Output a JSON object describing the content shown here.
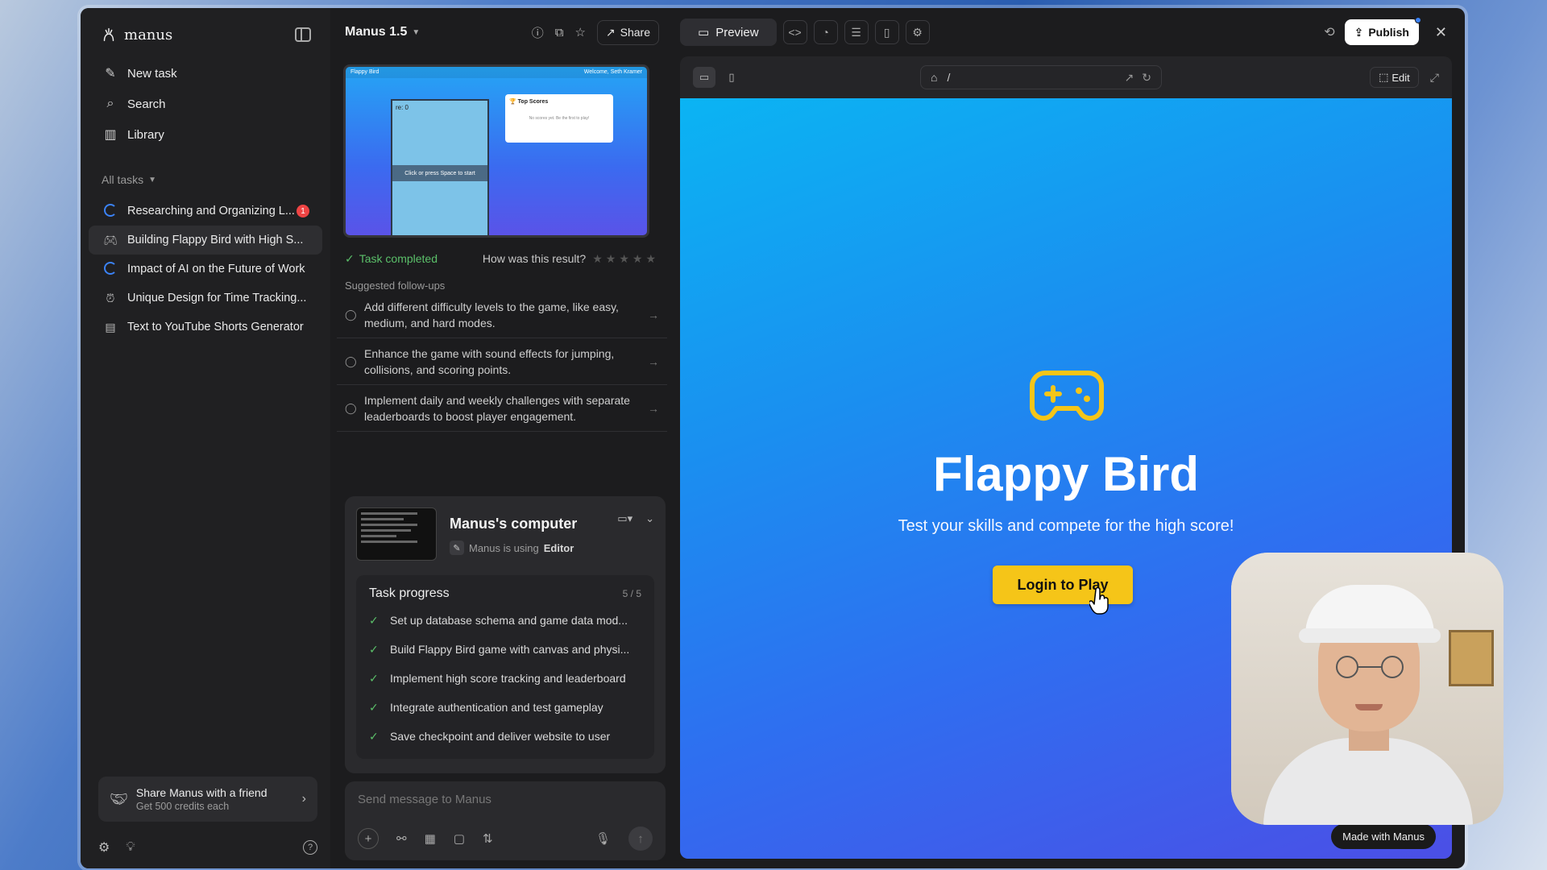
{
  "sidebar": {
    "brand": "manus",
    "nav": [
      {
        "label": "New task",
        "icon": "edit-icon"
      },
      {
        "label": "Search",
        "icon": "search-icon"
      },
      {
        "label": "Library",
        "icon": "library-icon"
      }
    ],
    "section_label": "All tasks",
    "tasks": [
      {
        "label": "Researching and Organizing L...",
        "icon": "spinner-icon",
        "badge": "1"
      },
      {
        "label": "Building Flappy Bird with High S...",
        "icon": "gamepad-icon"
      },
      {
        "label": "Impact of AI on the Future of Work",
        "icon": "spinner-icon"
      },
      {
        "label": "Unique Design for Time Tracking...",
        "icon": "clock-icon"
      },
      {
        "label": "Text to YouTube Shorts Generator",
        "icon": "document-icon"
      }
    ],
    "share": {
      "title": "Share Manus with a friend",
      "subtitle": "Get 500 credits each"
    }
  },
  "middle": {
    "model": "Manus 1.5",
    "share_label": "Share",
    "thumbnail": {
      "bar_title": "Flappy Bird",
      "bar_right": "Welcome, Seth Kramer",
      "score": "re: 0",
      "start": "Click or press Space to start",
      "scores_title": "🏆 Top Scores",
      "scores_msg": "No scores yet. Be the first to play!"
    },
    "task_completed": "Task completed",
    "rating_question": "How was this result?",
    "followups_label": "Suggested follow-ups",
    "followups": [
      "Add different difficulty levels to the game, like easy, medium, and hard modes.",
      "Enhance the game with sound effects for jumping, collisions, and scoring points.",
      "Implement daily and weekly challenges with separate leaderboards to boost player engagement."
    ],
    "computer": {
      "title": "Manus's computer",
      "status_prefix": "Manus is using",
      "status_tool": "Editor"
    },
    "progress": {
      "title": "Task progress",
      "count": "5 / 5",
      "items": [
        "Set up database schema and game data mod...",
        "Build Flappy Bird game with canvas and physi...",
        "Implement high score tracking and leaderboard",
        "Integrate authentication and test gameplay",
        "Save checkpoint and deliver website to user"
      ]
    },
    "message_placeholder": "Send message to Manus"
  },
  "right": {
    "preview_label": "Preview",
    "publish_label": "Publish",
    "url_path": "/",
    "edit_label": "Edit",
    "site": {
      "title": "Flappy Bird",
      "subtitle": "Test your skills and compete for the high score!",
      "login_label": "Login to Play",
      "made_with": "Made with Manus"
    }
  },
  "colors": {
    "accent_yellow": "#f5c518",
    "success_green": "#5bc06a",
    "badge_red": "#ef4444",
    "spinner_blue": "#3b82f6"
  }
}
